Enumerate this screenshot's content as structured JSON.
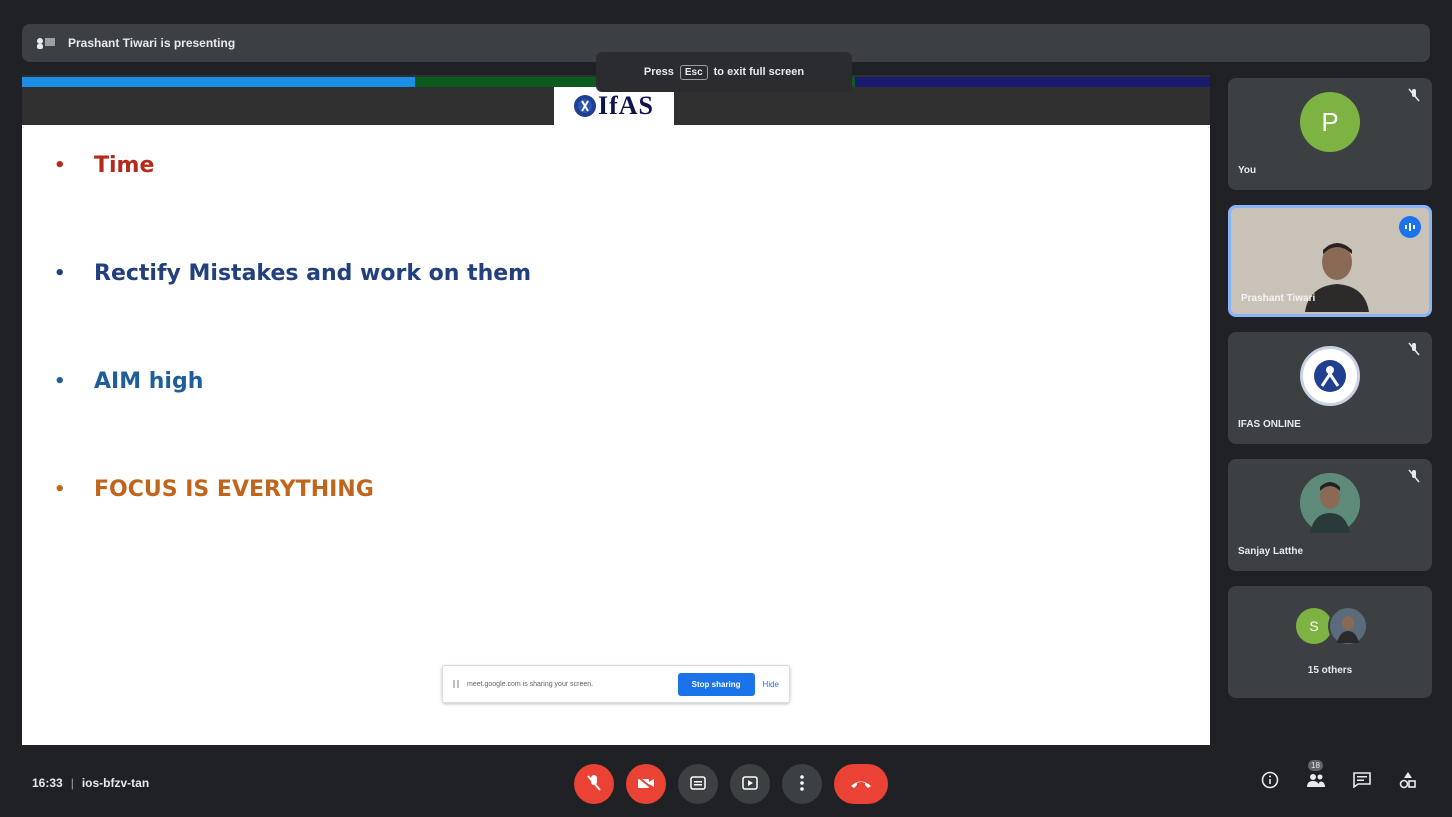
{
  "presenting": {
    "label": "Prashant Tiwari is presenting"
  },
  "slide": {
    "logo_text": "IfAS",
    "bullets": [
      {
        "text": "Time",
        "color": "#b52a1a"
      },
      {
        "text": "Rectify Mistakes and work on them",
        "color": "#23407e"
      },
      {
        "text": "AIM high",
        "color": "#1f5f99"
      },
      {
        "text": "FOCUS IS EVERYTHING",
        "color": "#c0661c"
      }
    ],
    "bullet_char": "•"
  },
  "fullscreen_toast": {
    "press": "Press",
    "key": "Esc",
    "suffix": "to exit full screen"
  },
  "share_bar": {
    "message": "meet.google.com is sharing your screen.",
    "stop_label": "Stop sharing",
    "hide_label": "Hide"
  },
  "participants": {
    "you": {
      "name": "You",
      "initial": "P",
      "icon": "mic-off-icon"
    },
    "presenter": {
      "name": "Prashant Tiwari",
      "icon": "speaking-icon"
    },
    "ifas": {
      "name": "IFAS ONLINE",
      "icon": "mic-off-icon"
    },
    "sanjay": {
      "name": "Sanjay Latthe",
      "icon": "mic-off-icon"
    },
    "others": {
      "label": "15 others",
      "initial": "S"
    }
  },
  "bottom_bar": {
    "time": "16:33",
    "separator": "|",
    "meeting_code": "ios-bfzv-tan",
    "controls": [
      "mic-off-icon",
      "camera-off-icon",
      "captions-icon",
      "present-icon",
      "more-icon",
      "hangup-icon"
    ],
    "people_count": "18",
    "right_icons": [
      "info-icon",
      "people-icon",
      "chat-icon",
      "activities-icon"
    ]
  },
  "colors": {
    "accent": "#1a73e8",
    "danger": "#ea4335",
    "tile_bg": "#3c4043",
    "page_bg": "#202124"
  }
}
